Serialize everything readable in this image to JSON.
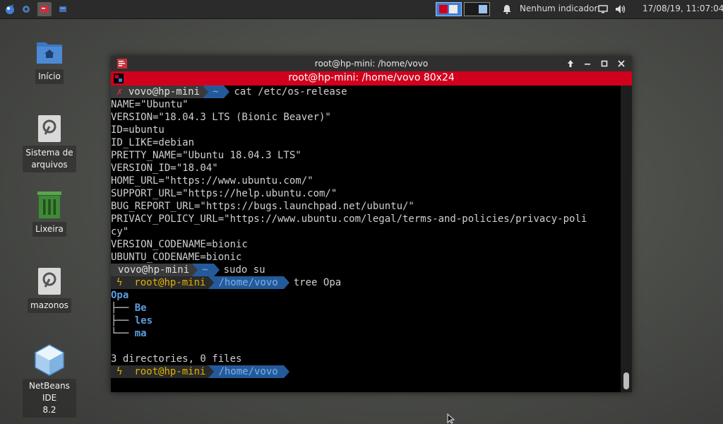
{
  "panel": {
    "workspaces": [
      "workspace-1",
      "workspace-2"
    ],
    "indicator_text": "Nenhum indicador",
    "clock": "17/08/19, 11:07:04"
  },
  "desktop": {
    "icons": [
      {
        "label": "Início",
        "icon": "home-folder-icon"
      },
      {
        "label": "Sistema de\narquivos",
        "icon": "drive-icon"
      },
      {
        "label": "Lixeira",
        "icon": "trash-icon"
      },
      {
        "label": "mazonos",
        "icon": "drive-icon"
      },
      {
        "label": "NetBeans IDE\n8.2",
        "icon": "netbeans-icon"
      }
    ]
  },
  "window": {
    "title": "root@hp-mini: /home/vovo",
    "tab_title": "root@hp-mini: /home/vovo 80x24"
  },
  "terminal": {
    "prompt1": {
      "status": "✗",
      "user": "vovo@hp-mini",
      "dir": "~",
      "cmd": "cat /etc/os-release"
    },
    "output": [
      "NAME=\"Ubuntu\"",
      "VERSION=\"18.04.3 LTS (Bionic Beaver)\"",
      "ID=ubuntu",
      "ID_LIKE=debian",
      "PRETTY_NAME=\"Ubuntu 18.04.3 LTS\"",
      "VERSION_ID=\"18.04\"",
      "HOME_URL=\"https://www.ubuntu.com/\"",
      "SUPPORT_URL=\"https://help.ubuntu.com/\"",
      "BUG_REPORT_URL=\"https://bugs.launchpad.net/ubuntu/\"",
      "PRIVACY_POLICY_URL=\"https://www.ubuntu.com/legal/terms-and-policies/privacy-poli",
      "cy\"",
      "VERSION_CODENAME=bionic",
      "UBUNTU_CODENAME=bionic"
    ],
    "prompt2": {
      "user": "vovo@hp-mini",
      "dir": "~",
      "cmd": "sudo su"
    },
    "prompt3": {
      "status": "ϟ",
      "user": "root@hp-mini",
      "dir": "/home/vovo",
      "cmd": "tree Opa"
    },
    "tree": {
      "root": "Opa",
      "children": [
        {
          "prefix": "├── ",
          "name": "Be"
        },
        {
          "prefix": "├── ",
          "name": "les"
        },
        {
          "prefix": "└── ",
          "name": "ma"
        }
      ],
      "summary": "3 directories, 0 files"
    },
    "prompt4": {
      "status": "ϟ",
      "user": "root@hp-mini",
      "dir": "/home/vovo"
    }
  }
}
